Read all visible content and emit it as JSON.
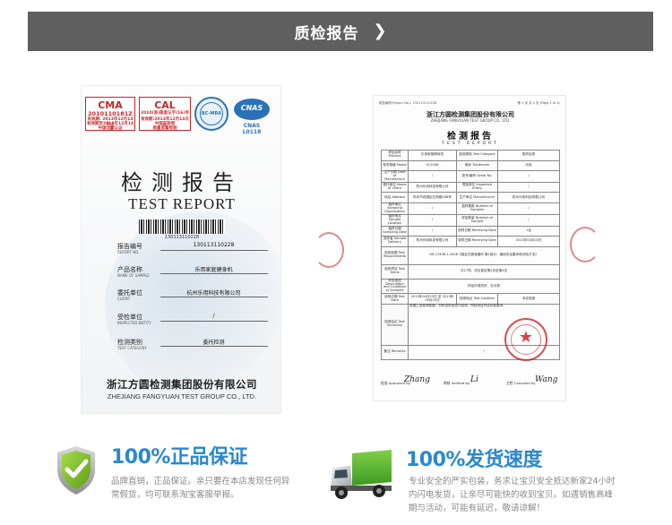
{
  "header": {
    "title": "质检报告",
    "chevron_icon": "chevron-right-icon"
  },
  "report": {
    "logos": [
      {
        "mark": "CMA",
        "code": "2010110181Z",
        "text1": "有效期: 2013年12月14日止",
        "text2": "有效期至2013年12月14日",
        "text3": "中国计量认证"
      },
      {
        "mark": "CAL",
        "code": "2010(浙)质监认字(16)号",
        "text1": "有效期:2013年12月14日止",
        "text2": "中国实验室",
        "text3": "质量监督检验"
      },
      {
        "mark": "BC-MRA"
      },
      {
        "mark": "CNAS",
        "code": "CNAS L0118"
      }
    ],
    "title_cn": "检测报告",
    "title_en": "TEST REPORT",
    "barcode_number": "130113110228",
    "fields": [
      {
        "label_cn": "报告编号",
        "label_en": "REPORT NO.",
        "value": "130113110228"
      },
      {
        "label_cn": "产品名称",
        "label_en": "NAME OF SAMPLE",
        "value": "乐用家庭健身机"
      },
      {
        "label_cn": "委托单位",
        "label_en": "CLIENT",
        "value": "杭州乐用科技有限公司"
      },
      {
        "label_cn": "受检单位",
        "label_en": "INSPECTED ENTITY",
        "value": "/"
      },
      {
        "label_cn": "检测类别",
        "label_en": "TEST CATEGORY",
        "value": "委托检测"
      }
    ],
    "company_cn": "浙江方圆检测集团股份有限公司",
    "company_en": "ZHEJIANG FANGYUAN TEST GROUP CO., LTD."
  },
  "certificate": {
    "top_left": "报告编号(Report No.): 130113110228",
    "top_right": "第 1 页 共 4 页 (Page 1 of 4)",
    "org_cn": "浙江方圆检测集团股份有限公司",
    "org_en": "ZHEJIANG FANGYUAN TEST GROUP CO., LTD.",
    "title_cn": "检测报告",
    "title_en": "TEST REPORT",
    "rows": [
      [
        "样品名称 Product",
        "乐用家庭健身机",
        "检测类别 Test Category",
        "委托检测"
      ],
      [
        "型号规格 Model",
        "LY-2008",
        "商标 Trademark",
        "乐用"
      ],
      [
        "生产日期 Date of Manufacture",
        "/",
        "批号/编号 Serial No.",
        "/"
      ],
      [
        "委托单位 Name of Client",
        "杭州乐用科技有限公司",
        "受检单位 Inspected Entity",
        "/"
      ],
      [
        "地址 Address",
        "杭州市西湖区石桥路288号",
        "生产单位 Manufacturer",
        "杭州乐用科技有限公司"
      ],
      [
        "抽样单位 Sampling Organization",
        "/",
        "抽样基数 Number of Samples",
        "/"
      ],
      [
        "抽样地点 Sample Location",
        "/",
        "样品数量 Number of Sample",
        "/"
      ],
      [
        "抽样日期 Sampling Date",
        "/",
        "到样日期 Receiving Date",
        "1台"
      ],
      [
        "送样者 Sample Delivery",
        "杭州乐用科技有限公司",
        "到样日期 Receiving Date",
        "2013年04月03日"
      ],
      [
        "检测依据 Test Requirements",
        "GB 17498.1-2008《固定式健身器材 第1部分：通用安全要求和试验方法》"
      ],
      [
        "检测项目 Test Items",
        "共17项，详见报告第2页至第4页"
      ],
      [
        "样品描述 Description and Condition of Samples",
        "样品外观完好，无污损"
      ],
      [
        "检测日期 Test Date",
        "2013年04月23日 至 2013年05月03日",
        "检测地点 Test Location",
        "本实验室"
      ],
      [
        "检测结论 Test Summary",
        "依据上述检测依据，对所送样品进行检测，所检项目符合标准要求。"
      ],
      [
        "备注 Remarks",
        "/"
      ]
    ],
    "sign_labels": [
      "批准 Approved by",
      "审核 Verified by",
      "主检 Compiled by"
    ],
    "signatures": [
      "Zhang",
      "Li",
      "Wang"
    ]
  },
  "features": [
    {
      "title": "100%正品保证",
      "desc": "品牌直销，正品保证。亲只要在本店发现任何异常假货，均可联系淘宝客服举报。",
      "icon": "shield-check-icon"
    },
    {
      "title": "100%发货速度",
      "desc": "专业安全的严实包装，务求让宝贝安全抵达新家24小时内闪电发货，让亲尽可能快的收到宝贝。如遇销售高峰期与活动，可能有延迟，敬请谅解！",
      "icon": "delivery-truck-icon"
    }
  ],
  "colors": {
    "header_bg": "#5f5f5f",
    "accent_blue": "#2a88d0",
    "stamp_red": "#c8252a",
    "shield_green": "#7cbf2c",
    "truck_green": "#58b030"
  }
}
